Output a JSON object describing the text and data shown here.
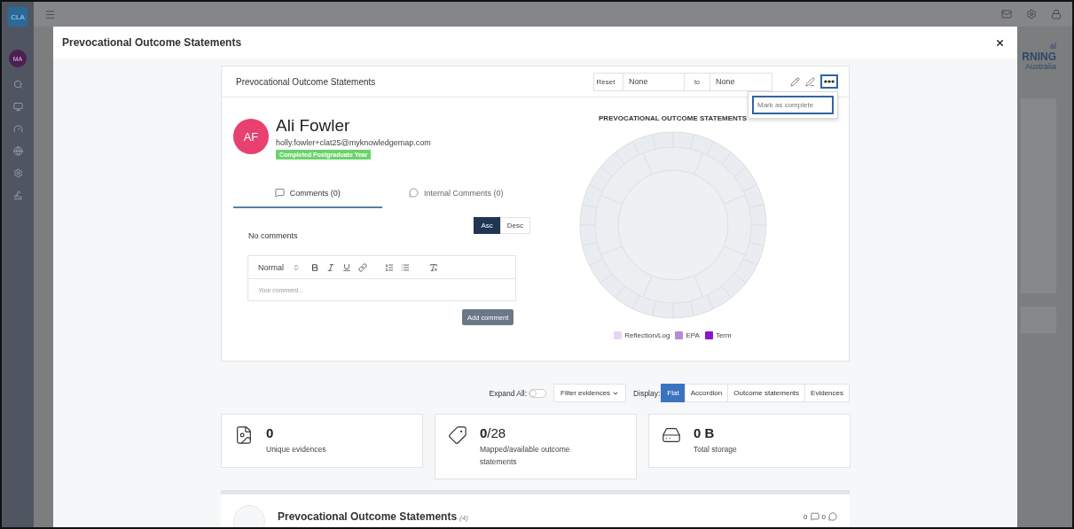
{
  "app": {
    "logo": "CLA",
    "user_initials": "MA"
  },
  "background_logo": [
    "al",
    "RNING",
    "Australia"
  ],
  "modal": {
    "title": "Prevocational Outcome Statements"
  },
  "card": {
    "title": "Prevocational Outcome Statements",
    "filter": {
      "reset": "Reset",
      "from": "None",
      "to_label": "to",
      "to": "None"
    },
    "menu": {
      "open": true,
      "items": [
        {
          "label": "Mark as complete",
          "selected": true
        }
      ]
    }
  },
  "profile": {
    "initials": "AF",
    "name": "Ali Fowler",
    "email": "holly.fowler+clat25@myknowledgemap.com",
    "badge": "Completed Postgraduate Year"
  },
  "comment_tabs": [
    {
      "label": "Comments (0)",
      "selected": true,
      "kind": "square"
    },
    {
      "label": "Internal Comments (0)",
      "selected": false,
      "kind": "round"
    }
  ],
  "sort": [
    {
      "label": "Asc",
      "selected": true
    },
    {
      "label": "Desc",
      "selected": false
    }
  ],
  "empty_message": "No comments",
  "editor": {
    "format": "Normal",
    "placeholder": "Your comment..."
  },
  "add_button": "Add comment",
  "chart": {
    "title": "PREVOCATIONAL OUTCOME STATEMENTS",
    "legend": [
      {
        "label": "Reflection/Log",
        "color": "#e8d6f2"
      },
      {
        "label": "EPA",
        "color": "#b98bd6"
      },
      {
        "label": "Term",
        "color": "#8a16c9"
      }
    ]
  },
  "toolbar": {
    "expand_label": "Expand All:",
    "expand_on": false,
    "filter_label": "Filter evidences",
    "display_label": "Display:",
    "display_options": [
      {
        "label": "Flat",
        "selected": true
      },
      {
        "label": "Accordion",
        "selected": false
      },
      {
        "label": "Outcome statements",
        "selected": false
      },
      {
        "label": "Evidences",
        "selected": false
      }
    ]
  },
  "stats": [
    {
      "kind": "evidence",
      "value": "0",
      "label": "Unique evidences"
    },
    {
      "kind": "mapped",
      "value": "**0**/28",
      "label": "Mapped/available outcome statements"
    },
    {
      "kind": "storage",
      "value": "0 B",
      "label": "Total storage"
    }
  ],
  "section": {
    "title": "Prevocational Outcome Statements",
    "count": "(4)",
    "comments": "0",
    "internal_comments": "0"
  }
}
